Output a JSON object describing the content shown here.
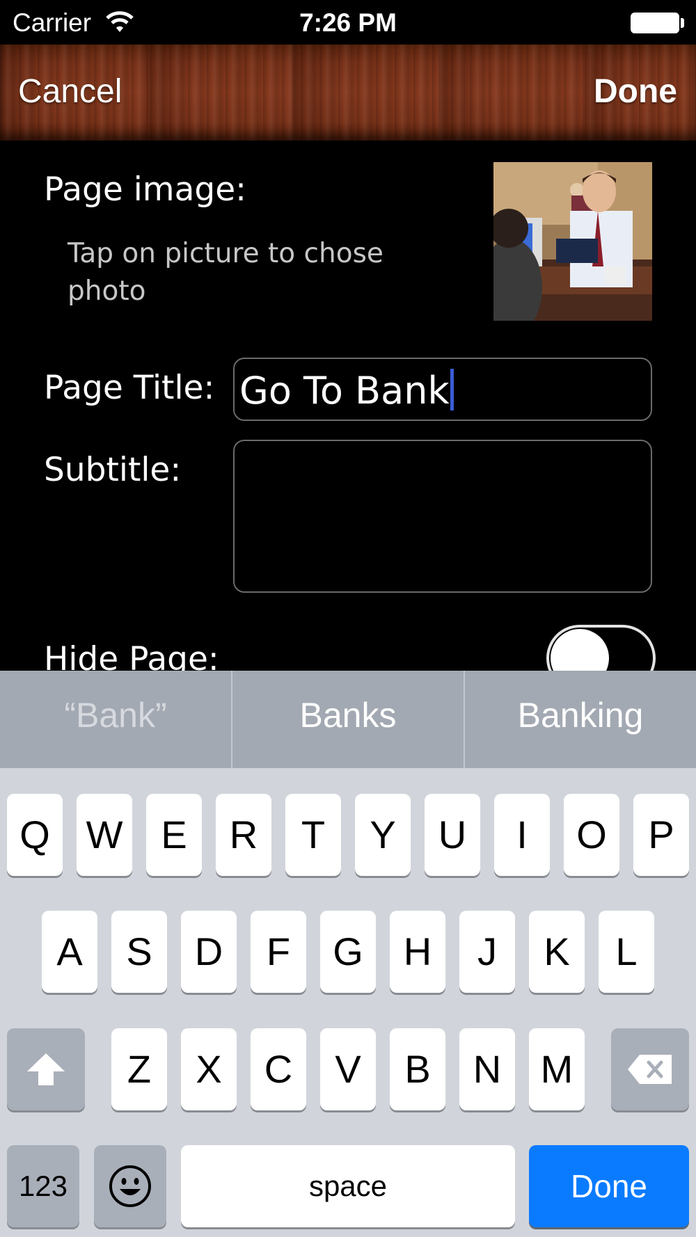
{
  "status_bar": {
    "carrier": "Carrier",
    "time": "7:26 PM"
  },
  "nav": {
    "cancel": "Cancel",
    "done": "Done"
  },
  "form": {
    "page_image_label": "Page image:",
    "page_image_hint": "Tap on picture to chose photo",
    "page_title_label": "Page Title:",
    "page_title_value": "Go To Bank",
    "subtitle_label": "Subtitle:",
    "subtitle_value": "",
    "hide_page_label": "Hide Page:",
    "hide_page_on": false
  },
  "keyboard": {
    "suggestions": [
      "“Bank”",
      "Banks",
      "Banking"
    ],
    "row1": [
      "Q",
      "W",
      "E",
      "R",
      "T",
      "Y",
      "U",
      "I",
      "O",
      "P"
    ],
    "row2": [
      "A",
      "S",
      "D",
      "F",
      "G",
      "H",
      "J",
      "K",
      "L"
    ],
    "row3": [
      "Z",
      "X",
      "C",
      "V",
      "B",
      "N",
      "M"
    ],
    "numbers_key": "123",
    "space_key": "space",
    "return_key": "Done",
    "icons": {
      "shift": "shift-icon",
      "delete": "backspace-icon",
      "emoji": "emoji-icon"
    },
    "return_color": "#0a7bff"
  }
}
